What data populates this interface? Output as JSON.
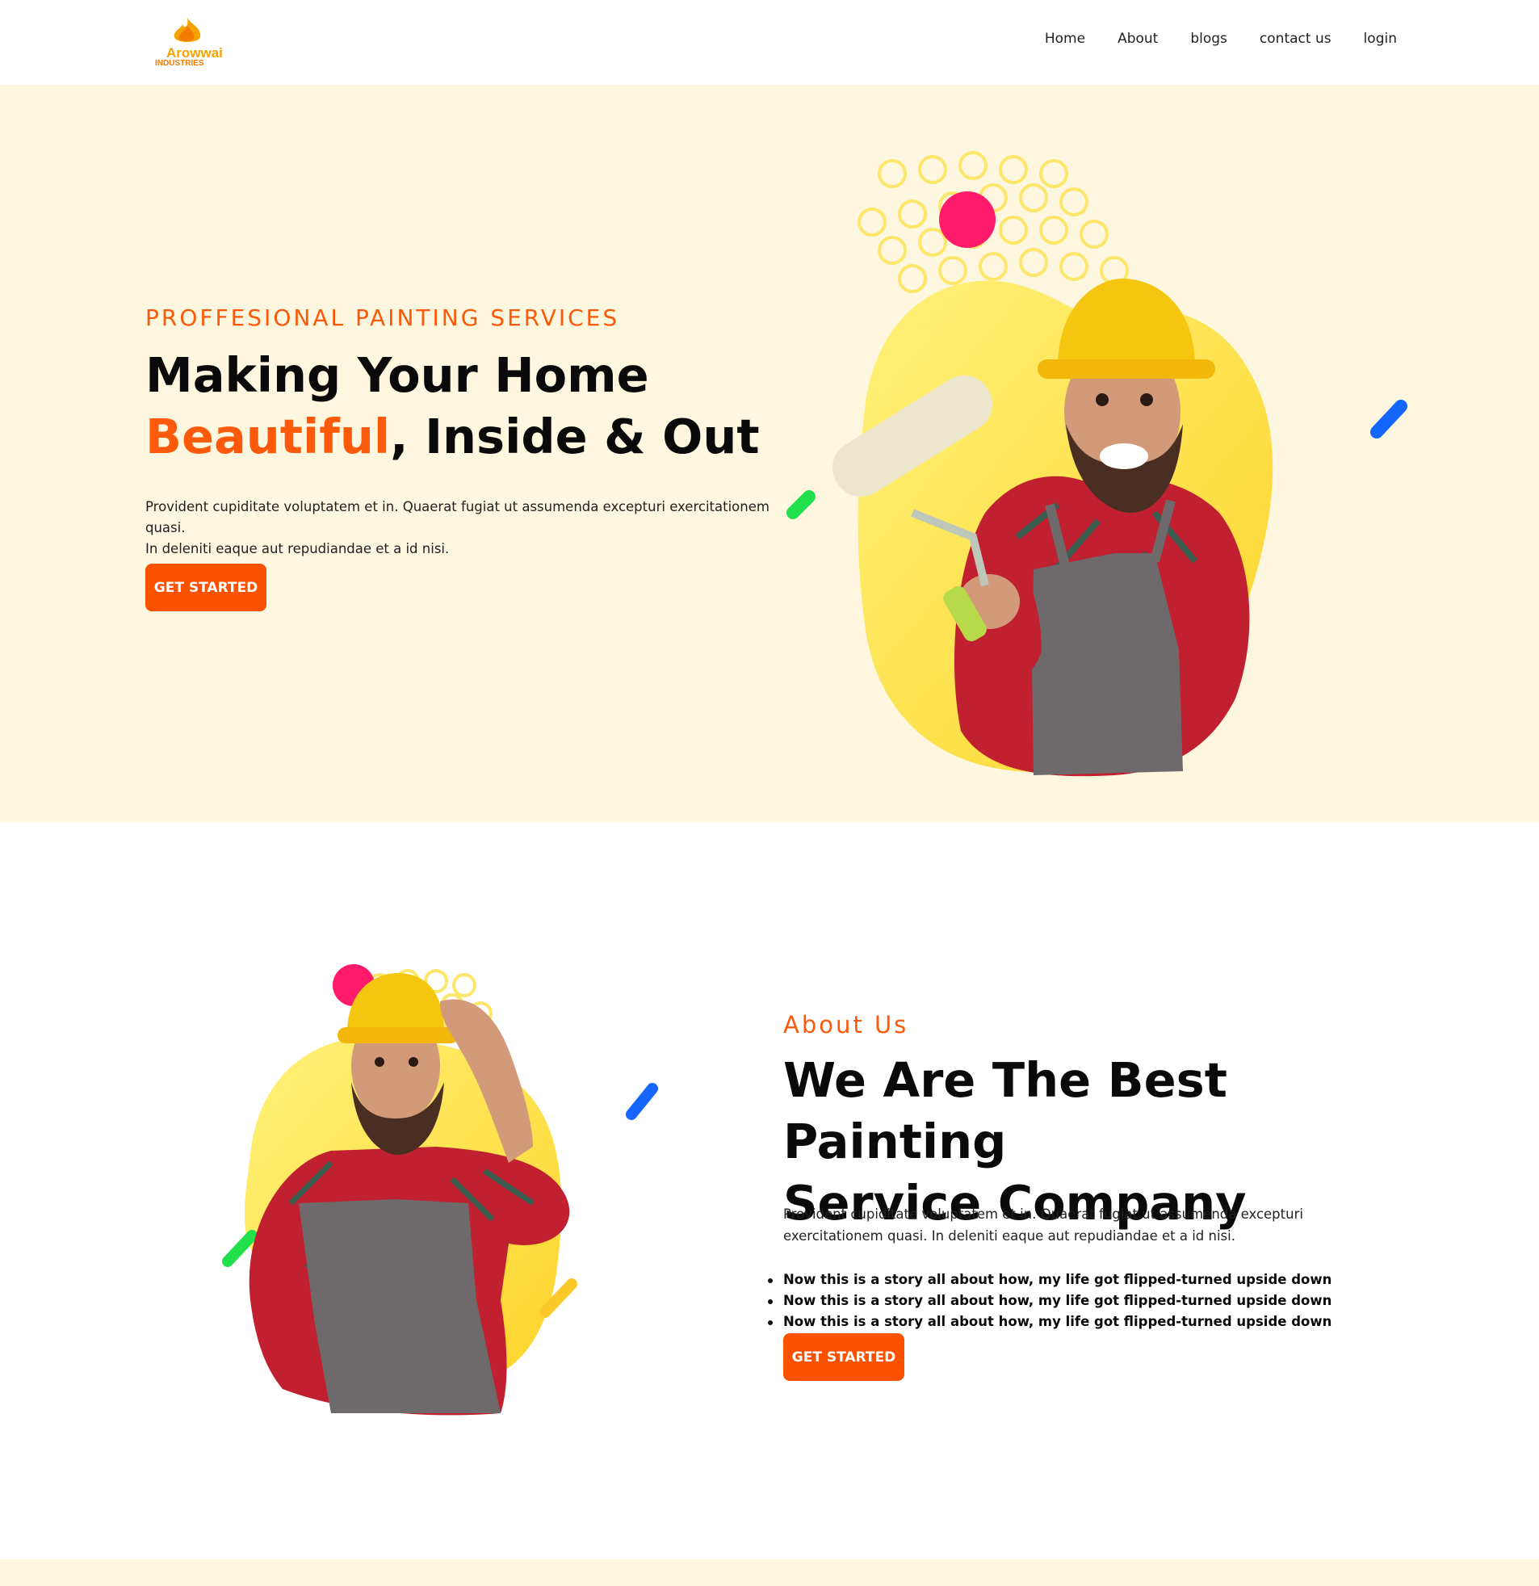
{
  "logo": {
    "name": "Arowwai",
    "sub": "INDUSTRIES"
  },
  "nav": {
    "links": [
      "Home",
      "About",
      "blogs",
      "contact us",
      "login"
    ]
  },
  "hero": {
    "subtitle": "PROFFESIONAL PAINTING SERVICES",
    "title_line1": "Making Your Home",
    "title_accent": "Beautiful",
    "title_rest": ", Inside & Out",
    "description_line1": "Provident cupiditate voluptatem et in. Quaerat fugiat ut assumenda excepturi exercitationem quasi.",
    "description_line2": "In deleniti eaque aut repudiandae et a id nisi.",
    "button": "GET STARTED"
  },
  "about": {
    "subtitle": "About Us",
    "title_line1": "We Are The Best Painting",
    "title_line2": "Service Company",
    "description": "Provident cupiditate voluptatem et in. Quaerat fugiat ut assumenda excepturi exercitationem quasi. In deleniti eaque aut repudiandae et a id nisi.",
    "list": [
      "Now this is a story all about how, my life got flipped-turned upside down",
      "Now this is a story all about how, my life got flipped-turned upside down",
      "Now this is a story all about how, my life got flipped-turned upside down"
    ],
    "button": "GET STARTED"
  },
  "colors": {
    "accent": "#fb5a0a",
    "button": "#fb5200",
    "hero_bg": "#fdf7df",
    "blob_yellow": "#fde047",
    "dot_pink": "#ff1a6b",
    "dash_blue": "#1565ff",
    "dash_green": "#22e04c"
  },
  "icons": [
    "logo-flame-icon",
    "painter-hero-illustration",
    "painter-about-illustration"
  ]
}
